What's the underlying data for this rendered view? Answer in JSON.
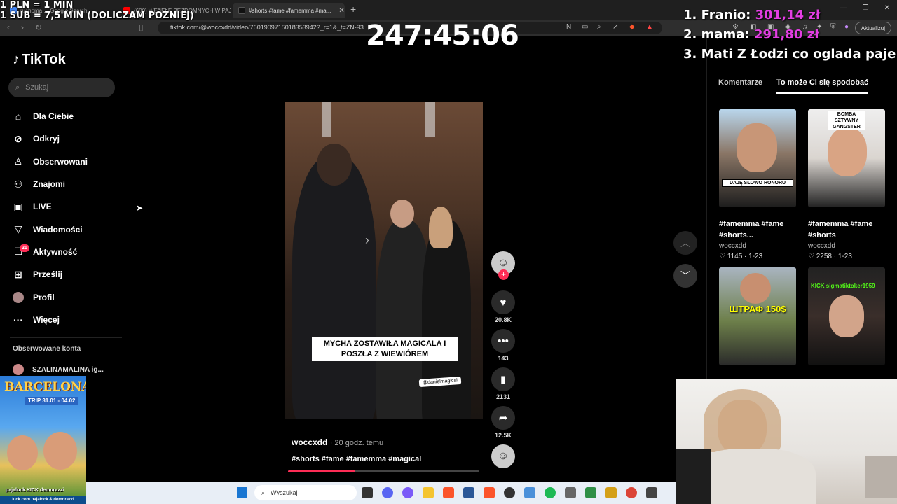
{
  "overlay": {
    "rate_line1": "1 PLN = 1 MIN",
    "rate_line2": "1 SUB = 7,5 MIN (DOLICZAM PÓŹNIEJ)",
    "timer": "247:45:06",
    "donors": [
      {
        "rank": "1.",
        "name": "Franio:",
        "amount": "301,14 zł"
      },
      {
        "rank": "2.",
        "name": "mama:",
        "amount": "291,80 zł"
      },
      {
        "rank": "3.",
        "name": "Mati Z Łodzi co oglada paje od",
        "amount": ""
      }
    ]
  },
  "browser": {
    "tabs": [
      {
        "label": "ruchoma ... Google Search",
        "color": "#4285f4"
      },
      {
        "label": "(600) WESELE BEZDOMNYCH W PAJ...",
        "color": "#ff0000"
      },
      {
        "label": "#shorts #fame #famemma #ma...",
        "color": "#000000"
      }
    ],
    "url": "tiktok.com/@woccxdd/video/7601909715018353942?_r=1&_t=ZN-93...",
    "update_label": "Aktualizuj"
  },
  "sidebar": {
    "logo": "TikTok",
    "search_placeholder": "Szukaj",
    "items": [
      {
        "label": "Dla Ciebie",
        "icon": "home-icon"
      },
      {
        "label": "Odkryj",
        "icon": "compass-icon"
      },
      {
        "label": "Obserwowani",
        "icon": "following-icon"
      },
      {
        "label": "Znajomi",
        "icon": "friends-icon"
      },
      {
        "label": "LIVE",
        "icon": "live-icon"
      },
      {
        "label": "Wiadomości",
        "icon": "messages-icon"
      },
      {
        "label": "Aktywność",
        "icon": "activity-icon",
        "badge": "21"
      },
      {
        "label": "Prześlij",
        "icon": "upload-icon"
      },
      {
        "label": "Profil",
        "icon": "profile-avatar"
      },
      {
        "label": "Więcej",
        "icon": "more-icon"
      }
    ],
    "followed_title": "Obserwowane konta",
    "followed_account": "SZALINAMALINA ig..."
  },
  "video": {
    "caption": "MYCHA ZOSTAWIŁA MAGICALA I POSZŁA Z WIEWIÓREM",
    "tag": "@danielmagical",
    "author": "woccxdd",
    "time": "· 20 godz. temu",
    "hashtags": "#shorts #fame #famemma #magical",
    "progress": 0.35,
    "likes": "20.8K",
    "comments": "143",
    "saves": "2131",
    "shares": "12.5K"
  },
  "right_panel": {
    "tab_comments": "Komentarze",
    "tab_recommended": "To może Ci się spodobać",
    "cards": [
      {
        "title": "#famemma #fame #shorts...",
        "author": "woccxdd",
        "likes": "1145",
        "date": "1-23",
        "overlay": "DAJĘ SŁOWO HONORU"
      },
      {
        "title": "#famemma #fame #shorts",
        "author": "woccxdd",
        "likes": "2258",
        "date": "1-23",
        "overlay": "BOMBA SZTYWNY GANGSTER"
      },
      {
        "title": "",
        "author": "",
        "likes": "",
        "date": "",
        "overlay": "ШТРАФ 150$"
      },
      {
        "title": "",
        "author": "",
        "likes": "",
        "date": "",
        "overlay": "KICK sigmatiktoker1959"
      }
    ]
  },
  "poster": {
    "title": "BARCELONA",
    "subtitle": "TRIP",
    "dates": "31.01 - 04.02",
    "handles": "pajalock  KICK  demorazzi",
    "footer": "kick.com pajalock & demorazzi"
  },
  "taskbar": {
    "search_placeholder": "Wyszukaj"
  }
}
